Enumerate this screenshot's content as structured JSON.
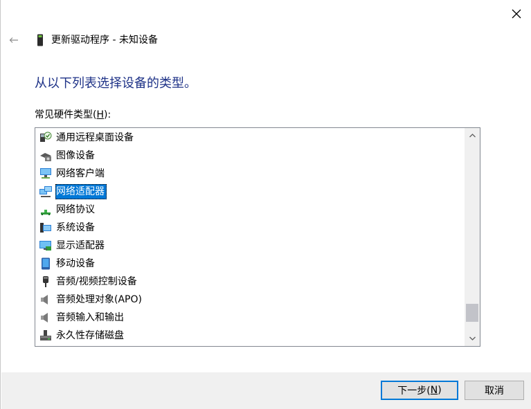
{
  "window": {
    "title": "更新驱动程序 - 未知设备",
    "close_glyph": "✕",
    "back_glyph": "←"
  },
  "main": {
    "heading": "从以下列表选择设备的类型。",
    "list_label_prefix": "常见硬件类型(",
    "list_label_accel": "H",
    "list_label_suffix": "):"
  },
  "hardware_types": [
    {
      "label": "通用远程桌面设备",
      "icon": "remote-desktop-icon"
    },
    {
      "label": "图像设备",
      "icon": "imaging-device-icon"
    },
    {
      "label": "网络客户端",
      "icon": "network-client-icon"
    },
    {
      "label": "网络适配器",
      "icon": "network-adapter-icon",
      "selected": true
    },
    {
      "label": "网络协议",
      "icon": "network-protocol-icon"
    },
    {
      "label": "系统设备",
      "icon": "system-device-icon"
    },
    {
      "label": "显示适配器",
      "icon": "display-adapter-icon"
    },
    {
      "label": "移动设备",
      "icon": "mobile-device-icon"
    },
    {
      "label": "音频/视频控制设备",
      "icon": "audio-video-control-icon"
    },
    {
      "label": "音频处理对象(APO)",
      "icon": "speaker-icon"
    },
    {
      "label": "音频输入和输出",
      "icon": "speaker-icon"
    },
    {
      "label": "永久性存储磁盘",
      "icon": "storage-disk-icon"
    }
  ],
  "scrollbar": {
    "up_glyph": "⌃",
    "down_glyph": "⌄"
  },
  "footer": {
    "next_prefix": "下一步(",
    "next_accel": "N",
    "next_suffix": ")",
    "cancel_label": "取消"
  },
  "colors": {
    "heading": "#1e3287",
    "selection": "#0078d7",
    "footer_bg": "#f0f0f0"
  }
}
